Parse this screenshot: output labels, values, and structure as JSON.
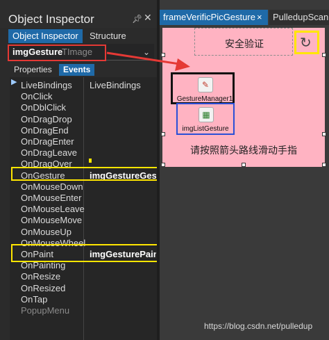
{
  "inspector": {
    "title": "Object Inspector",
    "pin_icon": "pin-icon",
    "close_icon": "close-icon",
    "tabs": {
      "inspector": "Object Inspector",
      "structure": "Structure"
    },
    "component": {
      "name": "imgGesture",
      "type": "TImage"
    },
    "subtabs": {
      "properties": "Properties",
      "events": "Events"
    },
    "events": [
      {
        "name": "LiveBindings",
        "value": "LiveBindings"
      },
      {
        "name": "OnClick",
        "value": ""
      },
      {
        "name": "OnDblClick",
        "value": ""
      },
      {
        "name": "OnDragDrop",
        "value": ""
      },
      {
        "name": "OnDragEnd",
        "value": ""
      },
      {
        "name": "OnDragEnter",
        "value": ""
      },
      {
        "name": "OnDragLeave",
        "value": ""
      },
      {
        "name": "OnDragOver",
        "value": ""
      },
      {
        "name": "OnGesture",
        "value": "imgGestureGest"
      },
      {
        "name": "OnMouseDown",
        "value": ""
      },
      {
        "name": "OnMouseEnter",
        "value": ""
      },
      {
        "name": "OnMouseLeave",
        "value": ""
      },
      {
        "name": "OnMouseMove",
        "value": ""
      },
      {
        "name": "OnMouseUp",
        "value": ""
      },
      {
        "name": "OnMouseWheel",
        "value": ""
      },
      {
        "name": "OnPaint",
        "value": "imgGesturePaint"
      },
      {
        "name": "OnPainting",
        "value": ""
      },
      {
        "name": "OnResize",
        "value": ""
      },
      {
        "name": "OnResized",
        "value": ""
      },
      {
        "name": "OnTap",
        "value": ""
      },
      {
        "name": "PopupMenu",
        "value": ""
      }
    ]
  },
  "designer": {
    "tabs": {
      "active": "frameVerificPicGesture",
      "close": "×",
      "second": "PulledupScan"
    },
    "header_text": "安全验证",
    "refresh_icon": "refresh-icon",
    "components": {
      "gesture_manager": "GestureManager1",
      "image_list": "imgListGesture"
    },
    "footer_text": "请按照箭头路线滑动手指"
  },
  "watermark": "https://blog.csdn.net/pulledup",
  "colors": {
    "accent": "#1f6aa8",
    "form_bg": "#ffb3c2",
    "highlight_yellow": "#ffe600",
    "highlight_red": "#e53935",
    "highlight_blue": "#2a4fd6"
  }
}
